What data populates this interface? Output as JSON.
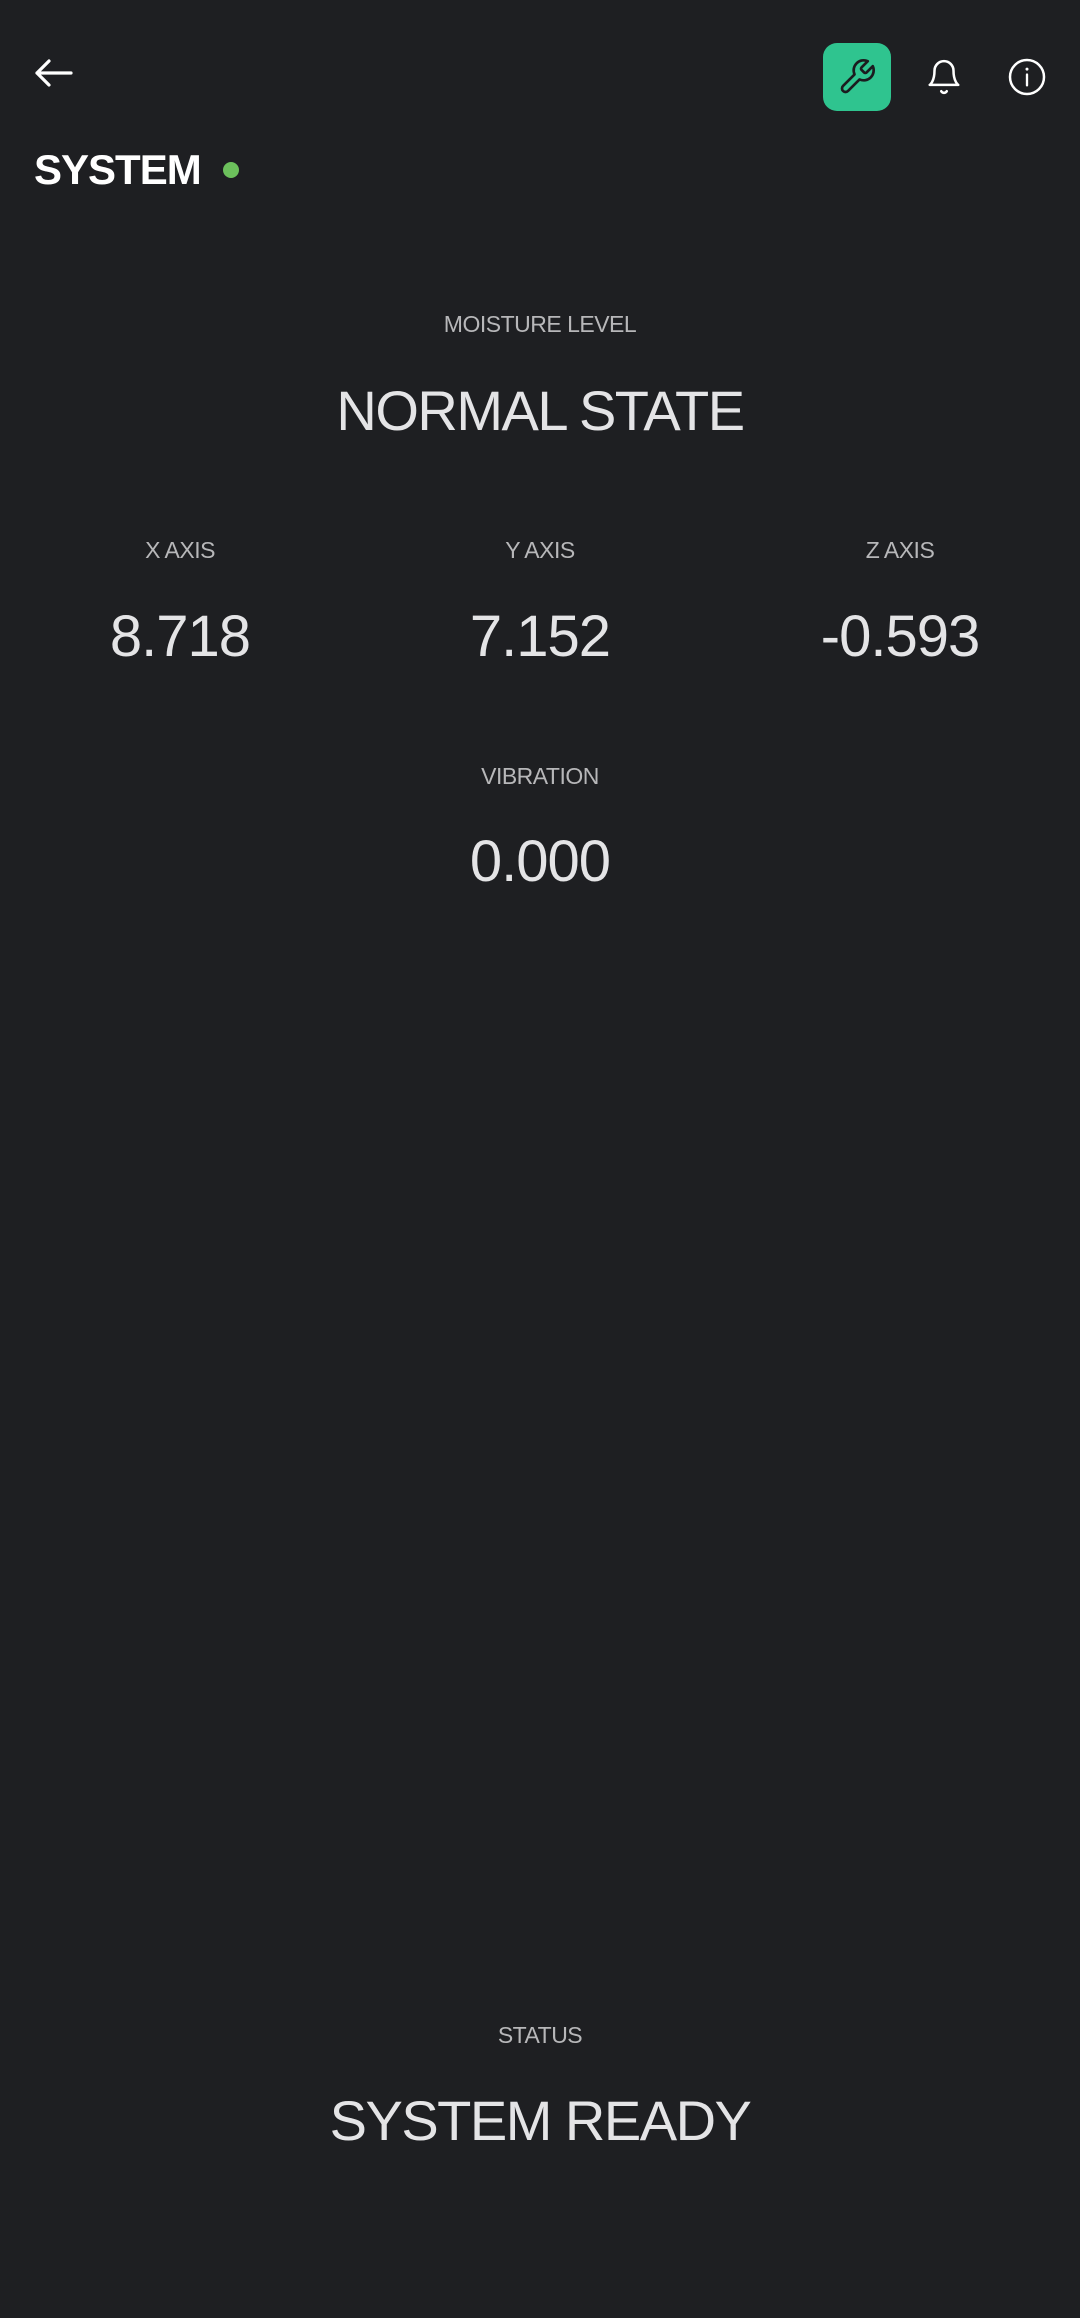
{
  "header": {
    "title": "SYSTEM",
    "back_icon": "arrow-left-icon",
    "tool_icon": "wrench-icon",
    "bell_icon": "bell-icon",
    "info_icon": "info-icon"
  },
  "colors": {
    "background": "#1e1f22",
    "accent": "#2fc48f",
    "status_dot": "#6cc05c"
  },
  "moisture": {
    "label": "MOISTURE LEVEL",
    "value": "NORMAL STATE"
  },
  "axes": {
    "x": {
      "label": "X AXIS",
      "value": "8.718"
    },
    "y": {
      "label": "Y AXIS",
      "value": "7.152"
    },
    "z": {
      "label": "Z AXIS",
      "value": "-0.593"
    }
  },
  "vibration": {
    "label": "VIBRATION",
    "value": "0.000"
  },
  "status": {
    "label": "STATUS",
    "value": "SYSTEM READY"
  }
}
